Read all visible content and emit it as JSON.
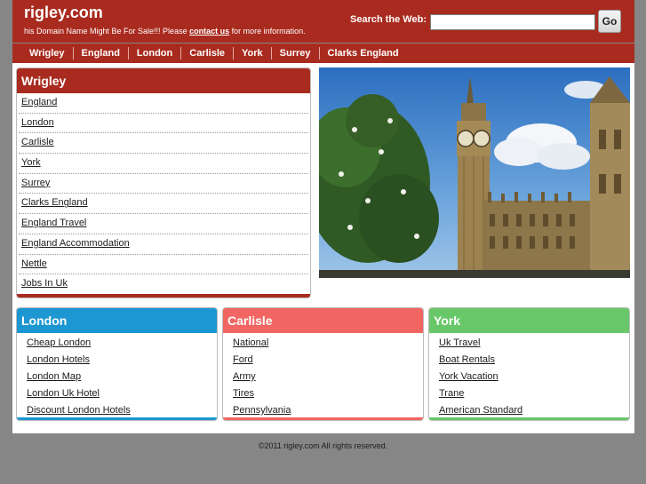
{
  "header": {
    "site_title": "rigley.com",
    "tagline_prefix": "his Domain Name Might Be For Sale!!! Please ",
    "tagline_link": "contact us",
    "tagline_suffix": " for more information.",
    "search_label": "Search the Web:",
    "search_value": "",
    "go_label": "Go"
  },
  "nav": {
    "items": [
      "Wrigley",
      "England",
      "London",
      "Carlisle",
      "York",
      "Surrey",
      "Clarks England"
    ]
  },
  "wrigley_box": {
    "title": "Wrigley",
    "links": [
      "England",
      "London",
      "Carlisle",
      "York",
      "Surrey",
      "Clarks England",
      "England Travel",
      "England Accommodation",
      "Nettle",
      "Jobs In Uk"
    ]
  },
  "london_box": {
    "title": "London",
    "links": [
      "Cheap London",
      "London Hotels",
      "London Map",
      "London Uk Hotel",
      "Discount London Hotels"
    ]
  },
  "carlisle_box": {
    "title": "Carlisle",
    "links": [
      "National",
      "Ford",
      "Army",
      "Tires",
      "Pennsylvania"
    ]
  },
  "york_box": {
    "title": "York",
    "links": [
      "Uk Travel",
      "Boat Rentals",
      "York Vacation",
      "Trane",
      "American Standard"
    ]
  },
  "footer": {
    "copyright": "©2011 rigley.com All rights reserved."
  },
  "colors": {
    "brand_red": "#a92b1f",
    "london_blue": "#1c97d1",
    "carlisle_red": "#f16662",
    "york_green": "#68c769",
    "page_background": "#868686"
  }
}
